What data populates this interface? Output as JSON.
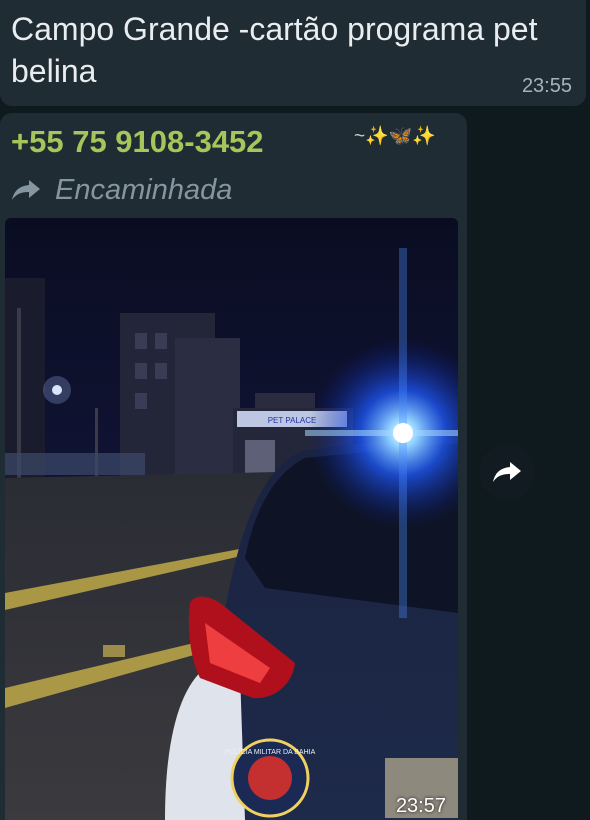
{
  "messages": {
    "top": {
      "text": "Campo Grande -cartão programa pet belina",
      "time": "23:55"
    },
    "forwarded": {
      "sender_phone": "+55 75 9108-3452",
      "sender_name": "~✨🦋✨",
      "forwarded_label": "Encaminhada",
      "media_time": "23:57",
      "photo_signs": {
        "storefront": "PET PALACE",
        "vehicle_badge": "POLÍCIA MILITAR DA BAHIA"
      }
    }
  },
  "colors": {
    "chat_background": "#0f1a1f",
    "bubble_incoming": "#1f2c34",
    "sender_phone": "#a6c55a",
    "message_text": "#e9edef",
    "meta_text": "#8696a0"
  },
  "icons": {
    "forwarded": "forward-arrow-icon",
    "share": "share-icon"
  }
}
